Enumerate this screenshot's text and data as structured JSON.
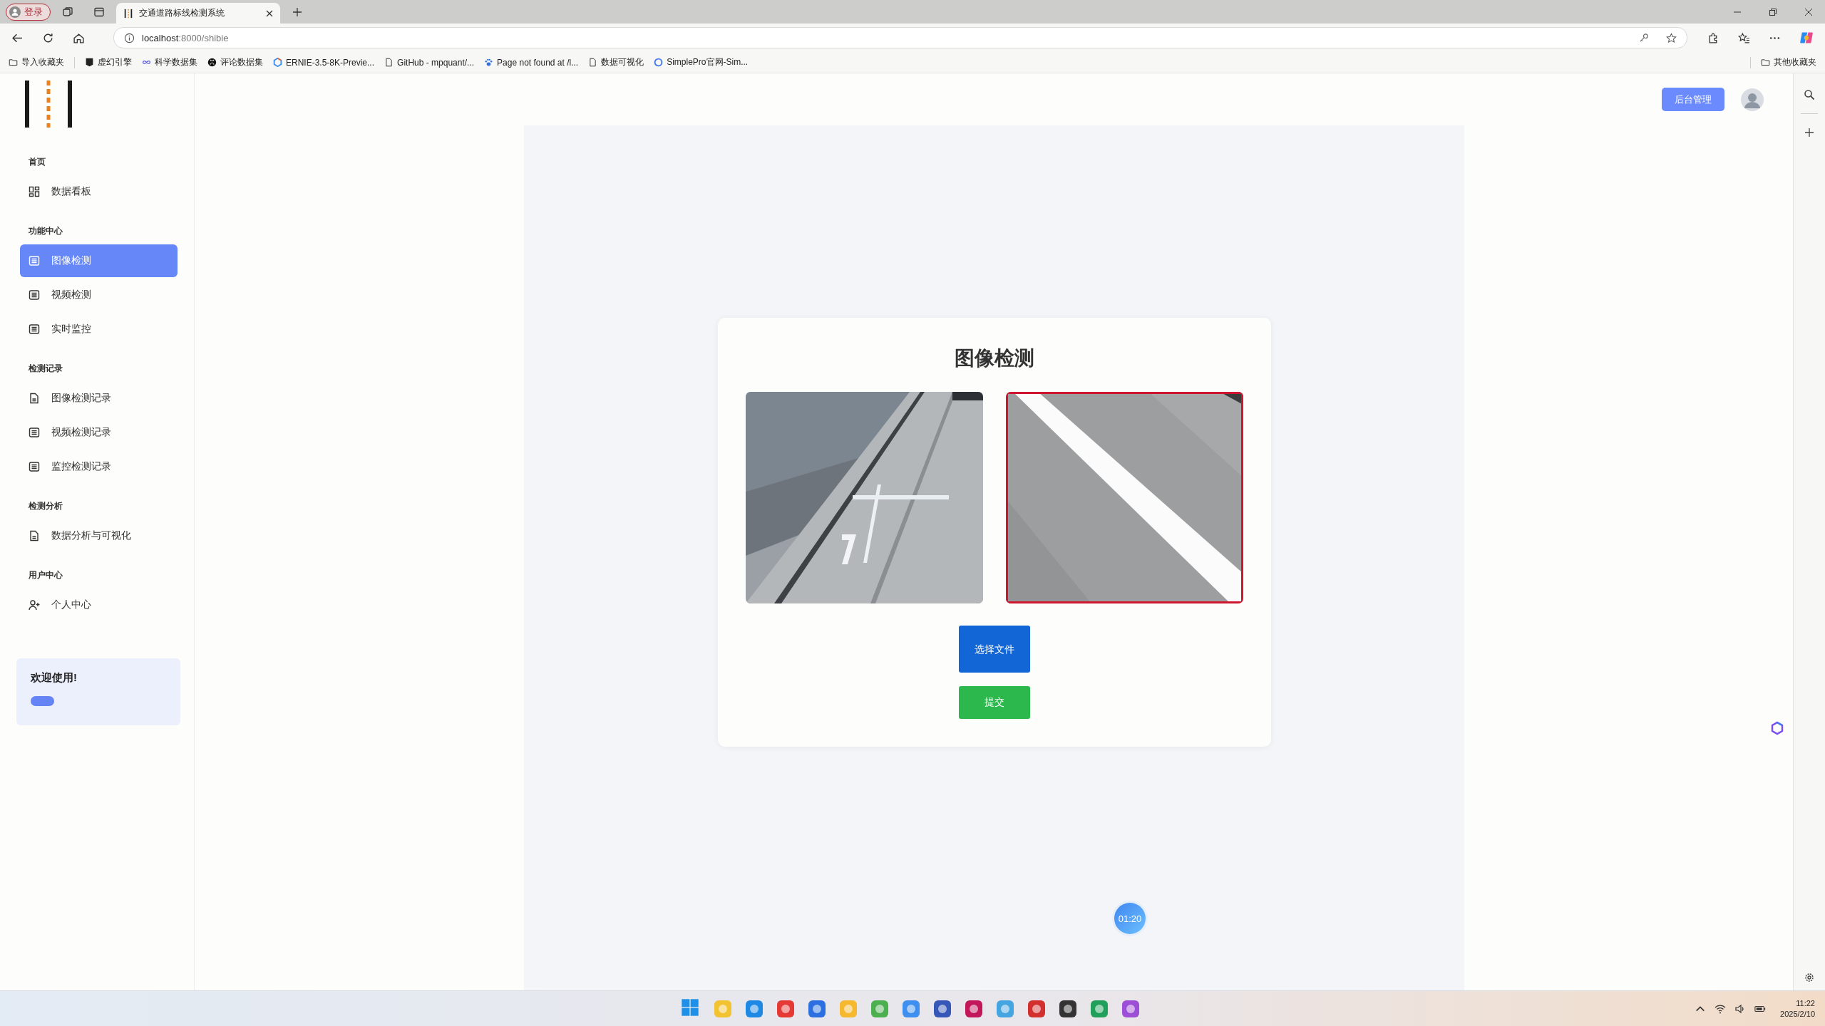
{
  "browser": {
    "profile_label": "登录",
    "tab_title": "交通道路标线检测系统",
    "address": {
      "host": "localhost",
      "rest": ":8000/shibie"
    },
    "bookmarks": [
      {
        "label": "导入收藏夹",
        "kind": "folder"
      },
      {
        "label": "虚幻引擎",
        "kind": "epic"
      },
      {
        "label": "科学数据集",
        "kind": "infinity"
      },
      {
        "label": "评论数据集",
        "kind": "github"
      },
      {
        "label": "ERNIE-3.5-8K-Previe...",
        "kind": "ernie"
      },
      {
        "label": "GitHub - mpquant/...",
        "kind": "page"
      },
      {
        "label": "Page not found at /l...",
        "kind": "paw"
      },
      {
        "label": "数据可视化",
        "kind": "page"
      },
      {
        "label": "SimplePro官网-Sim...",
        "kind": "simplepro"
      }
    ],
    "other_bookmarks": "其他收藏夹"
  },
  "sidebar": {
    "sections": [
      {
        "title": "首页",
        "items": [
          {
            "label": "数据看板",
            "kind": "grid",
            "selected": false
          }
        ]
      },
      {
        "title": "功能中心",
        "items": [
          {
            "label": "图像检测",
            "kind": "list",
            "selected": true
          },
          {
            "label": "视频检测",
            "kind": "list",
            "selected": false
          },
          {
            "label": "实时监控",
            "kind": "list",
            "selected": false
          }
        ]
      },
      {
        "title": "检测记录",
        "items": [
          {
            "label": "图像检测记录",
            "kind": "doc",
            "selected": false
          },
          {
            "label": "视频检测记录",
            "kind": "list",
            "selected": false
          },
          {
            "label": "监控检测记录",
            "kind": "list",
            "selected": false
          }
        ]
      },
      {
        "title": "检测分析",
        "items": [
          {
            "label": "数据分析与可视化",
            "kind": "doc",
            "selected": false
          }
        ]
      },
      {
        "title": "用户中心",
        "items": [
          {
            "label": "个人中心",
            "kind": "user",
            "selected": false
          }
        ]
      }
    ],
    "welcome": {
      "title": "欢迎使用!"
    }
  },
  "header": {
    "admin_button": "后台管理"
  },
  "card": {
    "title": "图像检测",
    "choose_button": "选择文件",
    "submit_button": "提交"
  },
  "timer": "01:20",
  "taskbar": {
    "time": "11:22",
    "date": "2025/2/10"
  }
}
